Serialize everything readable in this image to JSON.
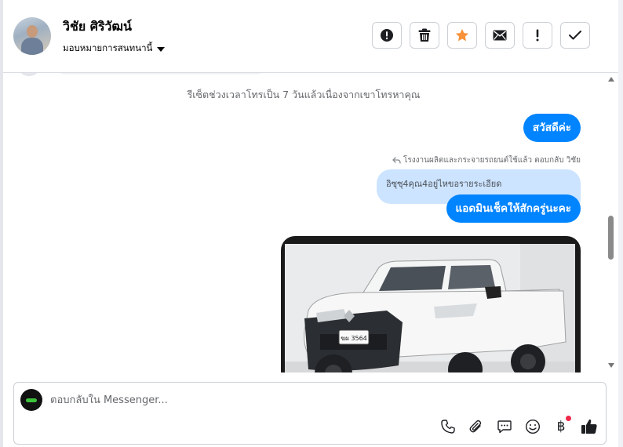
{
  "header": {
    "contact_name": "วิชัย ศิริวัฒน์",
    "assign_label": "มอบหมายการสนทนานี้",
    "toolbar": [
      {
        "name": "spam-button",
        "icon": "alert-circle-icon"
      },
      {
        "name": "delete-button",
        "icon": "trash-icon"
      },
      {
        "name": "star-button",
        "icon": "star-icon"
      },
      {
        "name": "mark-unread-button",
        "icon": "envelope-icon"
      },
      {
        "name": "follow-up-button",
        "icon": "exclamation-icon"
      },
      {
        "name": "mark-done-button",
        "icon": "checkmark-icon"
      }
    ]
  },
  "conversation": {
    "system_note": "รีเซ็ตช่วงเวลาโทรเป็น 7 วันแล้วเนื่องจากเขาโทรหาคุณ",
    "messages": [
      {
        "text": "สวัสดีค่ะ"
      },
      {
        "reply_info": "โรงงานผลิตและกระจายรถยนต์ใช้แล้ว ตอบกลับ วิชัย",
        "quoted_text": "อิซุซุ4คุณ4อยู่ไหขอรายระเอียด"
      },
      {
        "text": "แอดมินเช็คให้สักครู่นะคะ"
      }
    ],
    "photo": {
      "plate_text": "ฆผ 3564"
    }
  },
  "composer": {
    "placeholder": "ตอบกลับใน Messenger...",
    "currency_symbol": "฿",
    "icons": [
      "phone-icon",
      "paperclip-icon",
      "saved-reply-icon",
      "emoji-icon",
      "baht-icon",
      "thumbs-up-icon"
    ]
  },
  "colors": {
    "accent": "#0084ff",
    "quoted_bg": "#cce4ff",
    "star": "#f7923a",
    "notification": "#f02849"
  }
}
